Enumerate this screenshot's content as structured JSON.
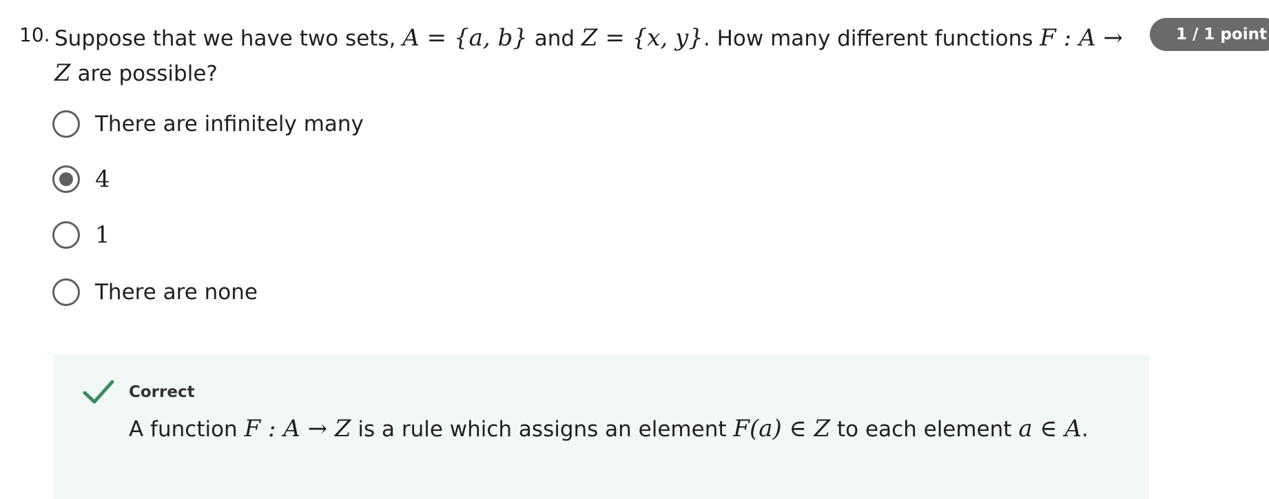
{
  "question": {
    "number": "10.",
    "text_1": "Suppose that we have two sets, ",
    "math_a": "A = {a, b}",
    "text_2": " and ",
    "math_z": "Z = {x, y}",
    "text_3": ". How many different functions ",
    "math_f": "F : A → Z",
    "text_4": " are possible?"
  },
  "points_badge": "1 / 1 point",
  "options": [
    {
      "label": "There are infinitely many",
      "selected": false
    },
    {
      "label": "4",
      "selected": true
    },
    {
      "label": "1",
      "selected": false
    },
    {
      "label": "There are none",
      "selected": false
    }
  ],
  "feedback": {
    "title": "Correct",
    "text_1": "A function ",
    "math_f": "F : A → Z",
    "text_2": " is a rule which assigns an element ",
    "math_fa": "F(a) ∈ Z",
    "text_3": " to each element ",
    "math_a": "a ∈ A",
    "text_4": "."
  },
  "icons": {
    "check": "check-icon",
    "radio_selected": "radio-selected-icon",
    "radio_empty": "radio-empty-icon"
  },
  "colors": {
    "check": "#3d8a5f",
    "badge": "#6b6b6b",
    "feedback_bg": "#f2f8f6",
    "radio": "#5f5f5f"
  }
}
